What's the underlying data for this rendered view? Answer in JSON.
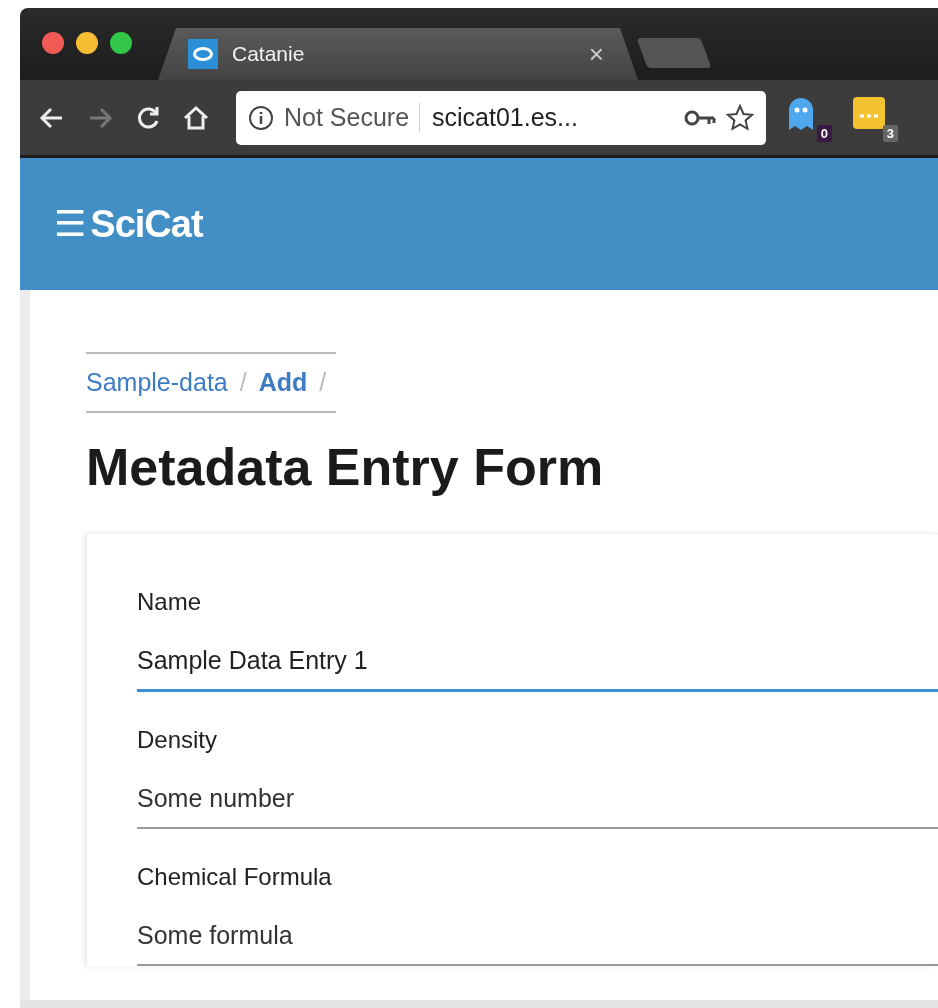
{
  "browser": {
    "tabs": [
      {
        "title": "Catanie",
        "close": "×",
        "selected": true
      }
    ],
    "toolbar": {
      "security": "Not Secure",
      "url": "scicat01.es...",
      "extensions": [
        {
          "badge": "0",
          "kind": "ghost"
        },
        {
          "badge": "3",
          "kind": "note"
        }
      ]
    }
  },
  "app_bar": {
    "menu": "☰",
    "title": "SciCat"
  },
  "breadcrumb": [
    {
      "label": "Sample-data",
      "separator": "/",
      "current": false
    },
    {
      "label": "Add",
      "separator": "/",
      "current": true
    }
  ],
  "page_title": "Metadata Entry Form",
  "form": {
    "fields": [
      {
        "label": "Name",
        "value": "Sample Data Entry 1",
        "focused": true
      },
      {
        "label": "Density",
        "placeholder": "Some number",
        "focused": false
      },
      {
        "label": "Chemical Formula",
        "placeholder": "Some formula",
        "focused": false
      }
    ]
  }
}
